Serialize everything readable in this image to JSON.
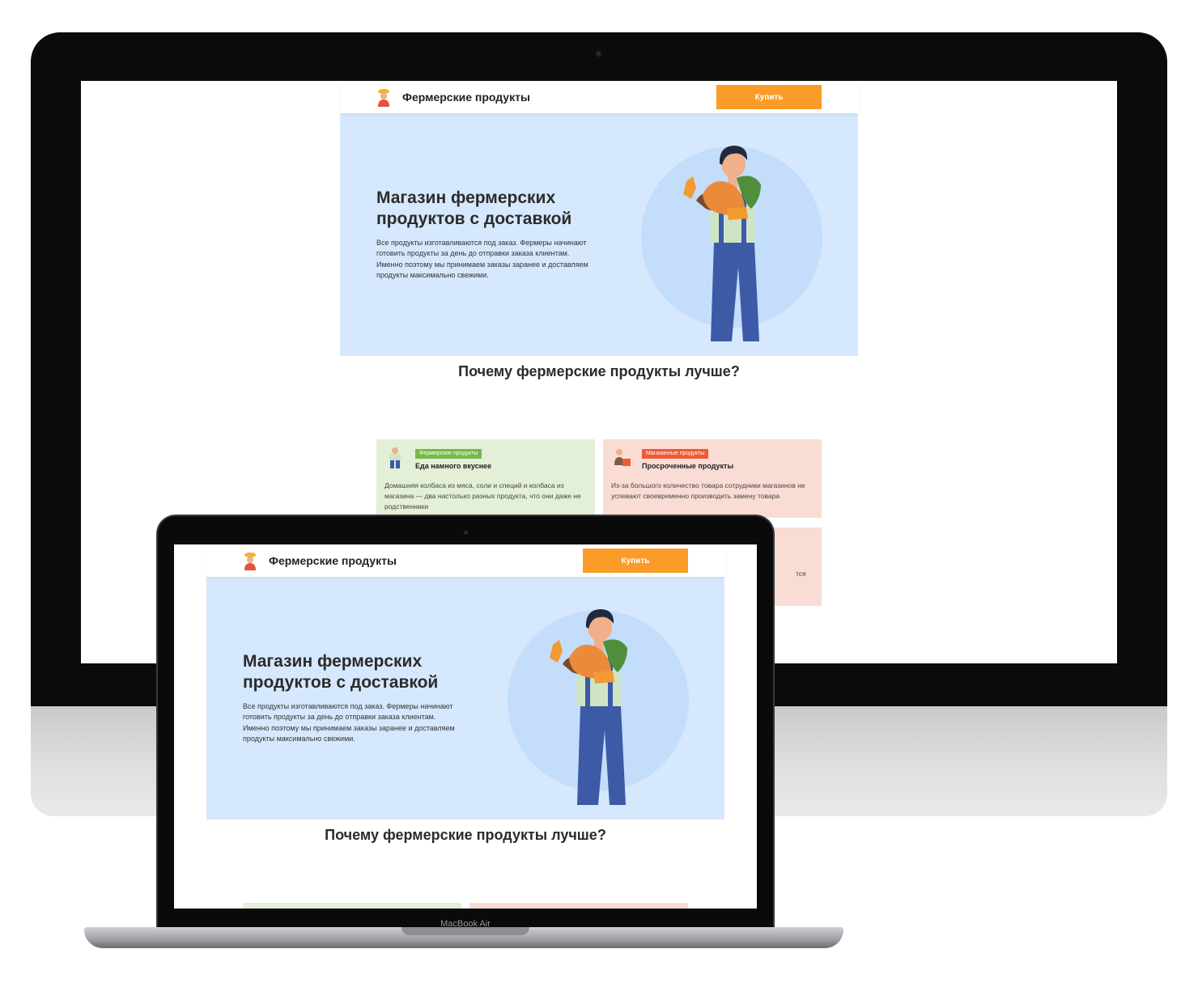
{
  "site": {
    "brand": "Фермерские продукты",
    "buy_label": "Купить",
    "hero": {
      "title": "Магазин фермерских продуктов с доставкой",
      "text": "Все продукты изготавливаются под заказ. Фермеры начинают готовить продукты за день до отправки заказа клиентам. Именно поэтому мы принимаем заказы заранее и доставляем продукты максимально свежими."
    },
    "why_title": "Почему фермерские продукты лучше?",
    "cards": [
      {
        "tag": "Фермерские продукты",
        "title": "Еда намного вкуснее",
        "text": "Домашняя колбаса из мяса, соли и специй и колбаса из магазина — два настолько разных продукта, что они даже не родственники",
        "variant": "green"
      },
      {
        "tag": "Магазинные продукты",
        "title": "Просроченные продукты",
        "text": "Из-за большого количество товара сотрудники магазинов не успевают своевременно производить замену товара",
        "variant": "red"
      }
    ],
    "card3_tail": "тся"
  },
  "laptop": {
    "label": "MacBook Air"
  },
  "colors": {
    "accent": "#fb9b28",
    "hero_bg": "#d6e8fd",
    "hero_circle": "#c3ddfb",
    "card_green": "#e3efd6",
    "card_red": "#f9ddd4",
    "tag_green": "#77b84b",
    "tag_red": "#ee5a37"
  },
  "icons": [
    "farmer-logo-icon",
    "farmer-illustration",
    "farmer-small-icon",
    "store-shopper-icon"
  ]
}
